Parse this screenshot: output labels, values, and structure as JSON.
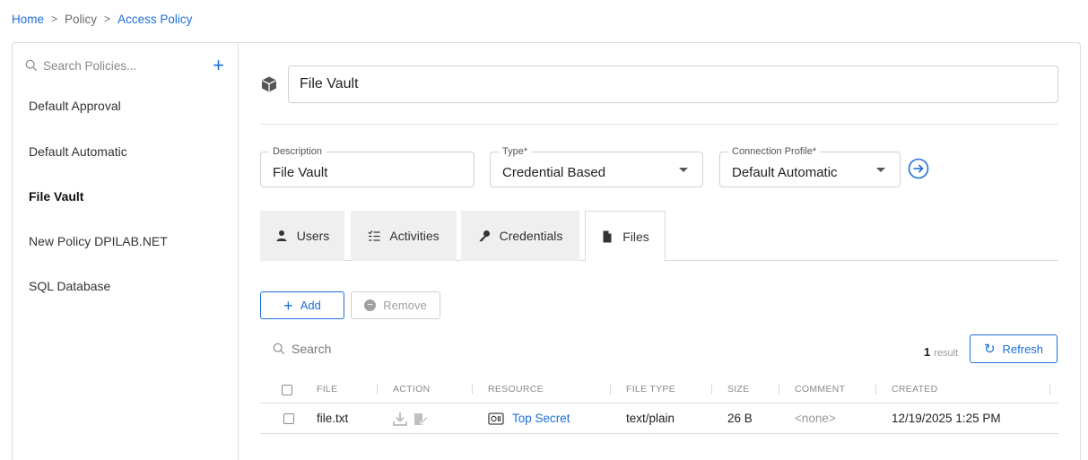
{
  "breadcrumb": {
    "home": "Home",
    "policy": "Policy",
    "current": "Access Policy",
    "separator": ">"
  },
  "sidebar": {
    "search_placeholder": "Search Policies...",
    "add_glyph": "+",
    "items": [
      {
        "label": "Default Approval",
        "active": false
      },
      {
        "label": "Default Automatic",
        "active": false
      },
      {
        "label": "File Vault",
        "active": true
      },
      {
        "label": "New Policy DPILAB.NET",
        "active": false
      },
      {
        "label": "SQL Database",
        "active": false
      }
    ]
  },
  "policy": {
    "name": "File Vault",
    "icon": "cube-icon",
    "description": {
      "label": "Description",
      "value": "File Vault"
    },
    "type": {
      "label": "Type*",
      "value": "Credential Based"
    },
    "connection_profile": {
      "label": "Connection Profile*",
      "value": "Default Automatic"
    }
  },
  "tabs": [
    {
      "label": "Users",
      "icon": "user-icon",
      "active": false
    },
    {
      "label": "Activities",
      "icon": "checklist-icon",
      "active": false
    },
    {
      "label": "Credentials",
      "icon": "key-icon",
      "active": false
    },
    {
      "label": "Files",
      "icon": "file-icon",
      "active": true
    }
  ],
  "actions": {
    "add_label": "Add",
    "remove_label": "Remove"
  },
  "table": {
    "search_placeholder": "Search",
    "result_count": "1",
    "result_label": "result",
    "refresh_label": "Refresh",
    "columns": [
      "FILE",
      "ACTION",
      "RESOURCE",
      "FILE TYPE",
      "SIZE",
      "COMMENT",
      "CREATED"
    ],
    "rows": [
      {
        "file": "file.txt",
        "resource": "Top Secret",
        "file_type": "text/plain",
        "size": "26 B",
        "comment": "<none>",
        "created": "12/19/2025 1:25 PM"
      }
    ]
  },
  "colors": {
    "accent": "#1e6fd9",
    "border": "#dcdcdc",
    "tab_inactive_bg": "#efefef",
    "muted": "#9a9a9a"
  }
}
